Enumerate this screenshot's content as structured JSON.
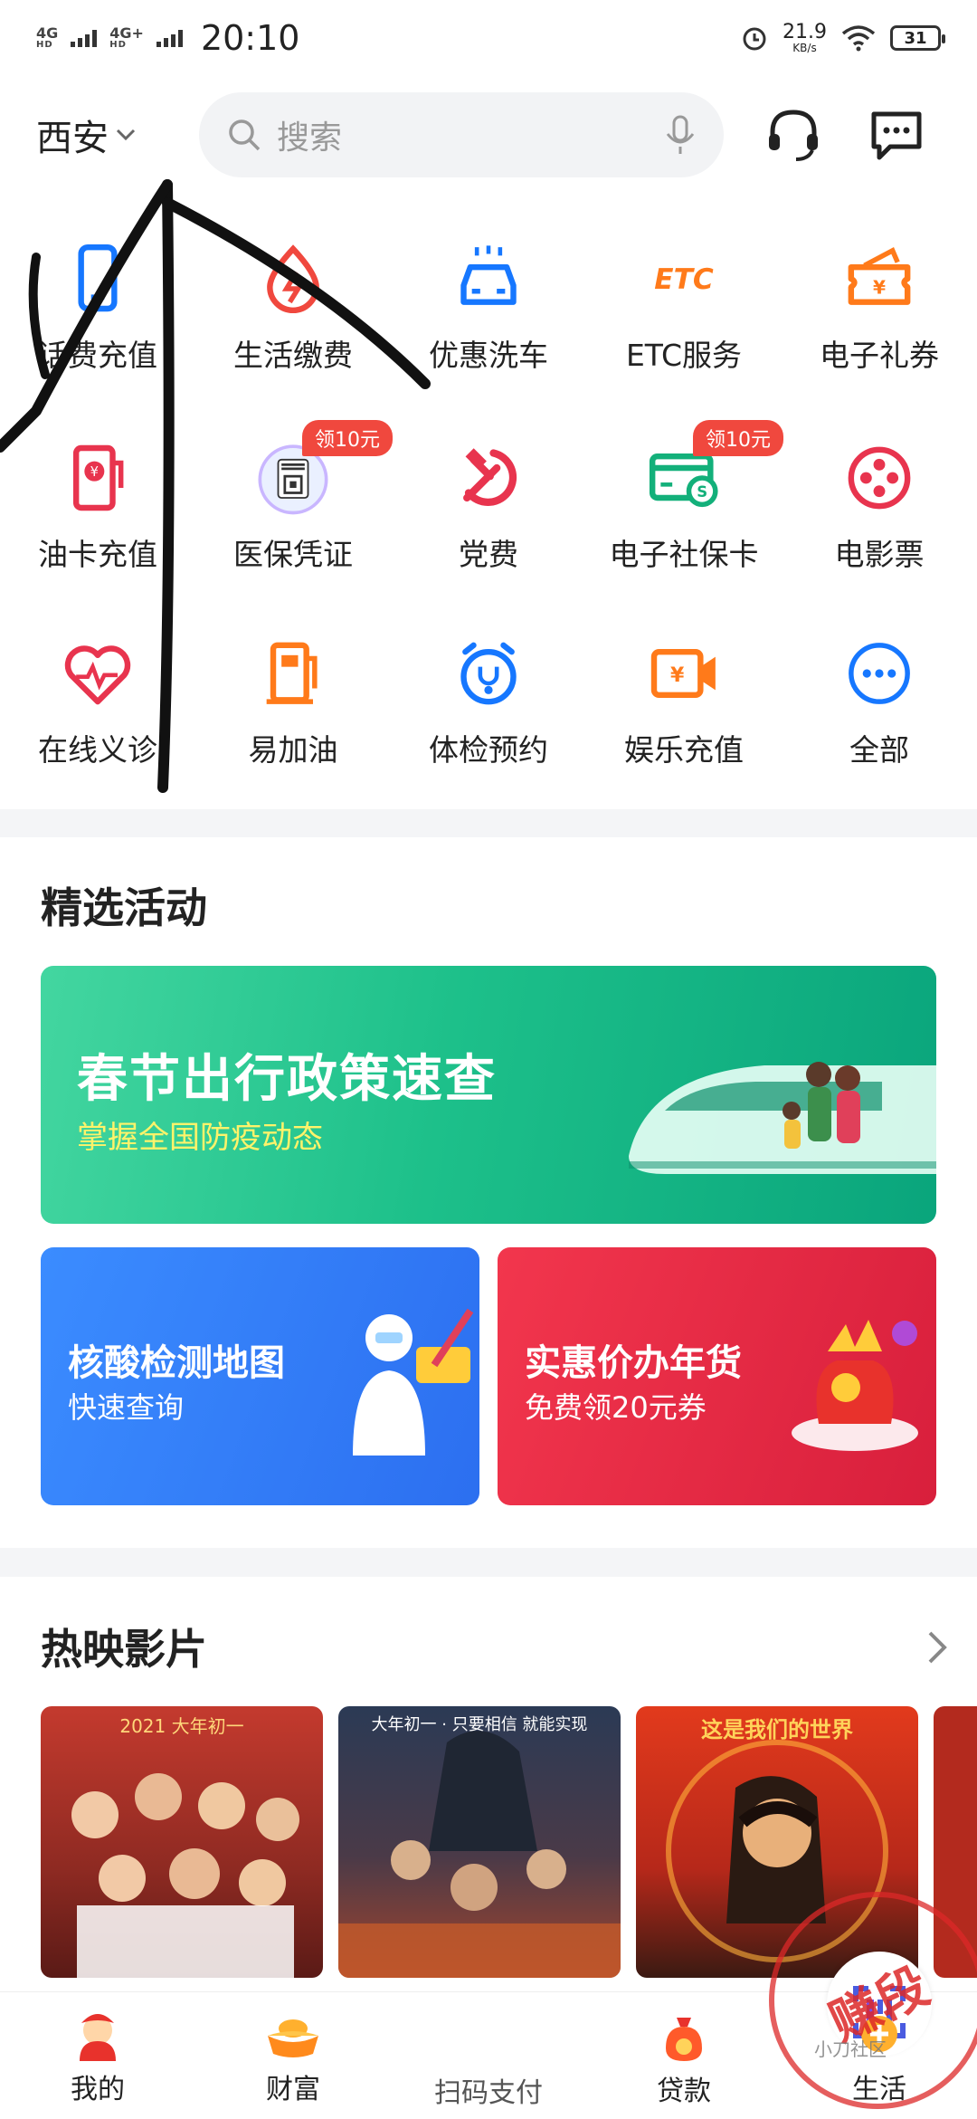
{
  "status_bar": {
    "network_1": "4G",
    "network_1_sub": "HD",
    "network_2": "4G+",
    "network_2_sub": "HD",
    "time": "20:10",
    "speed_value": "21.9",
    "speed_unit": "KB/s",
    "battery": "31"
  },
  "header": {
    "city": "西安",
    "search_placeholder": "搜索"
  },
  "services": [
    {
      "label": "话费充值",
      "icon": "phone-icon"
    },
    {
      "label": "生活缴费",
      "icon": "bolt-icon"
    },
    {
      "label": "优惠洗车",
      "icon": "car-wash-icon"
    },
    {
      "label": "ETC服务",
      "icon": "etc-icon"
    },
    {
      "label": "电子礼券",
      "icon": "coupon-icon"
    },
    {
      "label": "油卡充值",
      "icon": "fuel-card-icon"
    },
    {
      "label": "医保凭证",
      "icon": "medical-qr-icon",
      "badge": "领10元"
    },
    {
      "label": "党费",
      "icon": "hammer-sickle-icon"
    },
    {
      "label": "电子社保卡",
      "icon": "social-card-icon",
      "badge": "领10元"
    },
    {
      "label": "电影票",
      "icon": "film-reel-icon"
    },
    {
      "label": "在线义诊",
      "icon": "heart-pulse-icon"
    },
    {
      "label": "易加油",
      "icon": "gas-pump-icon"
    },
    {
      "label": "体检预约",
      "icon": "alarm-stethoscope-icon"
    },
    {
      "label": "娱乐充值",
      "icon": "video-yuan-icon"
    },
    {
      "label": "全部",
      "icon": "more-icon"
    }
  ],
  "activities": {
    "title": "精选活动",
    "main_banner": {
      "title": "春节出行政策速查",
      "subtitle": "掌握全国防疫动态"
    },
    "left_banner": {
      "title": "核酸检测地图",
      "subtitle": "快速查询"
    },
    "right_banner": {
      "title": "实惠价办年货",
      "subtitle": "免费领20元券"
    }
  },
  "films": {
    "title": "热映影片",
    "poster_1_text": "2021 大年初一",
    "poster_2_text": "大年初一 · 只要相信 就能实现",
    "poster_3_text": "这是我们的世界"
  },
  "bottom_nav": [
    {
      "label": "我的"
    },
    {
      "label": "财富"
    },
    {
      "label": "扫码支付"
    },
    {
      "label": "贷款"
    },
    {
      "label": "生活"
    }
  ],
  "watermark": {
    "stamp": "赚段",
    "community": "小刀社区"
  },
  "colors": {
    "accent_red": "#f0483e",
    "icon_blue": "#1677ff",
    "icon_orange": "#ff7a1a",
    "activity_green": "#1dc08a"
  }
}
